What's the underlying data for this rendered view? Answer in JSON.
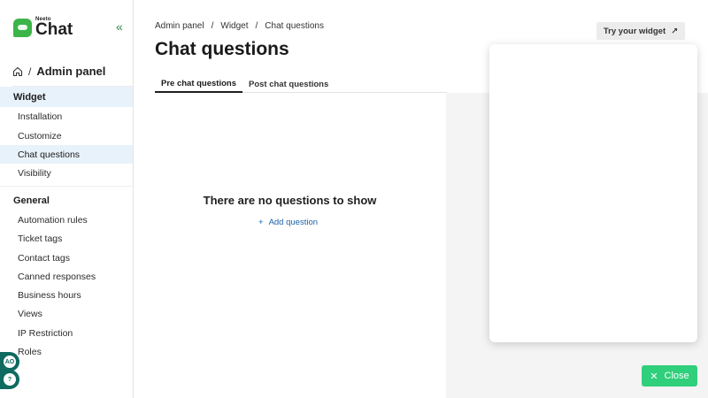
{
  "brand": {
    "small": "Neeto",
    "big": "Chat"
  },
  "sidebar": {
    "home_title": "Admin panel",
    "home_sep": "/",
    "sections": [
      {
        "label": "Widget",
        "items": [
          {
            "label": "Installation"
          },
          {
            "label": "Customize"
          },
          {
            "label": "Chat questions"
          },
          {
            "label": "Visibility"
          }
        ]
      },
      {
        "label": "General",
        "items": [
          {
            "label": "Automation rules"
          },
          {
            "label": "Ticket tags"
          },
          {
            "label": "Contact tags"
          },
          {
            "label": "Canned responses"
          },
          {
            "label": "Business hours"
          },
          {
            "label": "Views"
          },
          {
            "label": "IP Restriction"
          },
          {
            "label": "Roles"
          }
        ]
      }
    ],
    "avatar_initials": "AO",
    "help_glyph": "?"
  },
  "breadcrumb": {
    "items": [
      "Admin panel",
      "Widget",
      "Chat questions"
    ],
    "sep": "/"
  },
  "page_title": "Chat questions",
  "try_widget": {
    "label": "Try your widget",
    "icon": "↗"
  },
  "tabs": [
    {
      "label": "Pre chat questions"
    },
    {
      "label": "Post chat questions"
    }
  ],
  "empty_state": {
    "title": "There are no questions to show",
    "add_label": "Add question",
    "add_icon": "+"
  },
  "close_button": {
    "label": "Close",
    "icon": "✕"
  },
  "colors": {
    "brand_green": "#3bb54a",
    "active_bg": "#e8f2fb",
    "link_blue": "#1d5fa8",
    "close_green": "#2fcf7b",
    "fab_teal": "#0f6a5f"
  }
}
